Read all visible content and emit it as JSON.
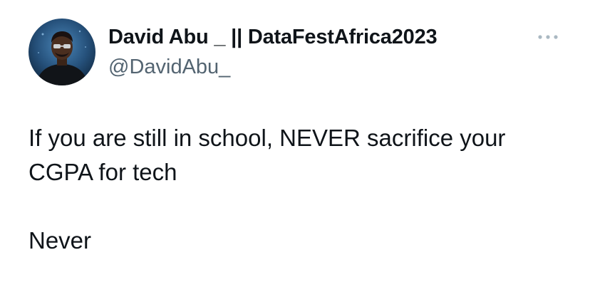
{
  "author": {
    "display_name": "David Abu _ || DataFestAfrica2023",
    "handle": "@DavidAbu_",
    "avatar_icon": "user-avatar"
  },
  "menu": {
    "icon": "more-horizontal-icon"
  },
  "tweet": {
    "lines": [
      "If you are still in school, NEVER sacrifice your",
      "CGPA for tech",
      "Never"
    ]
  },
  "colors": {
    "text": "#0f1419",
    "secondary": "#536471",
    "more_icon": "#aab8c2"
  }
}
